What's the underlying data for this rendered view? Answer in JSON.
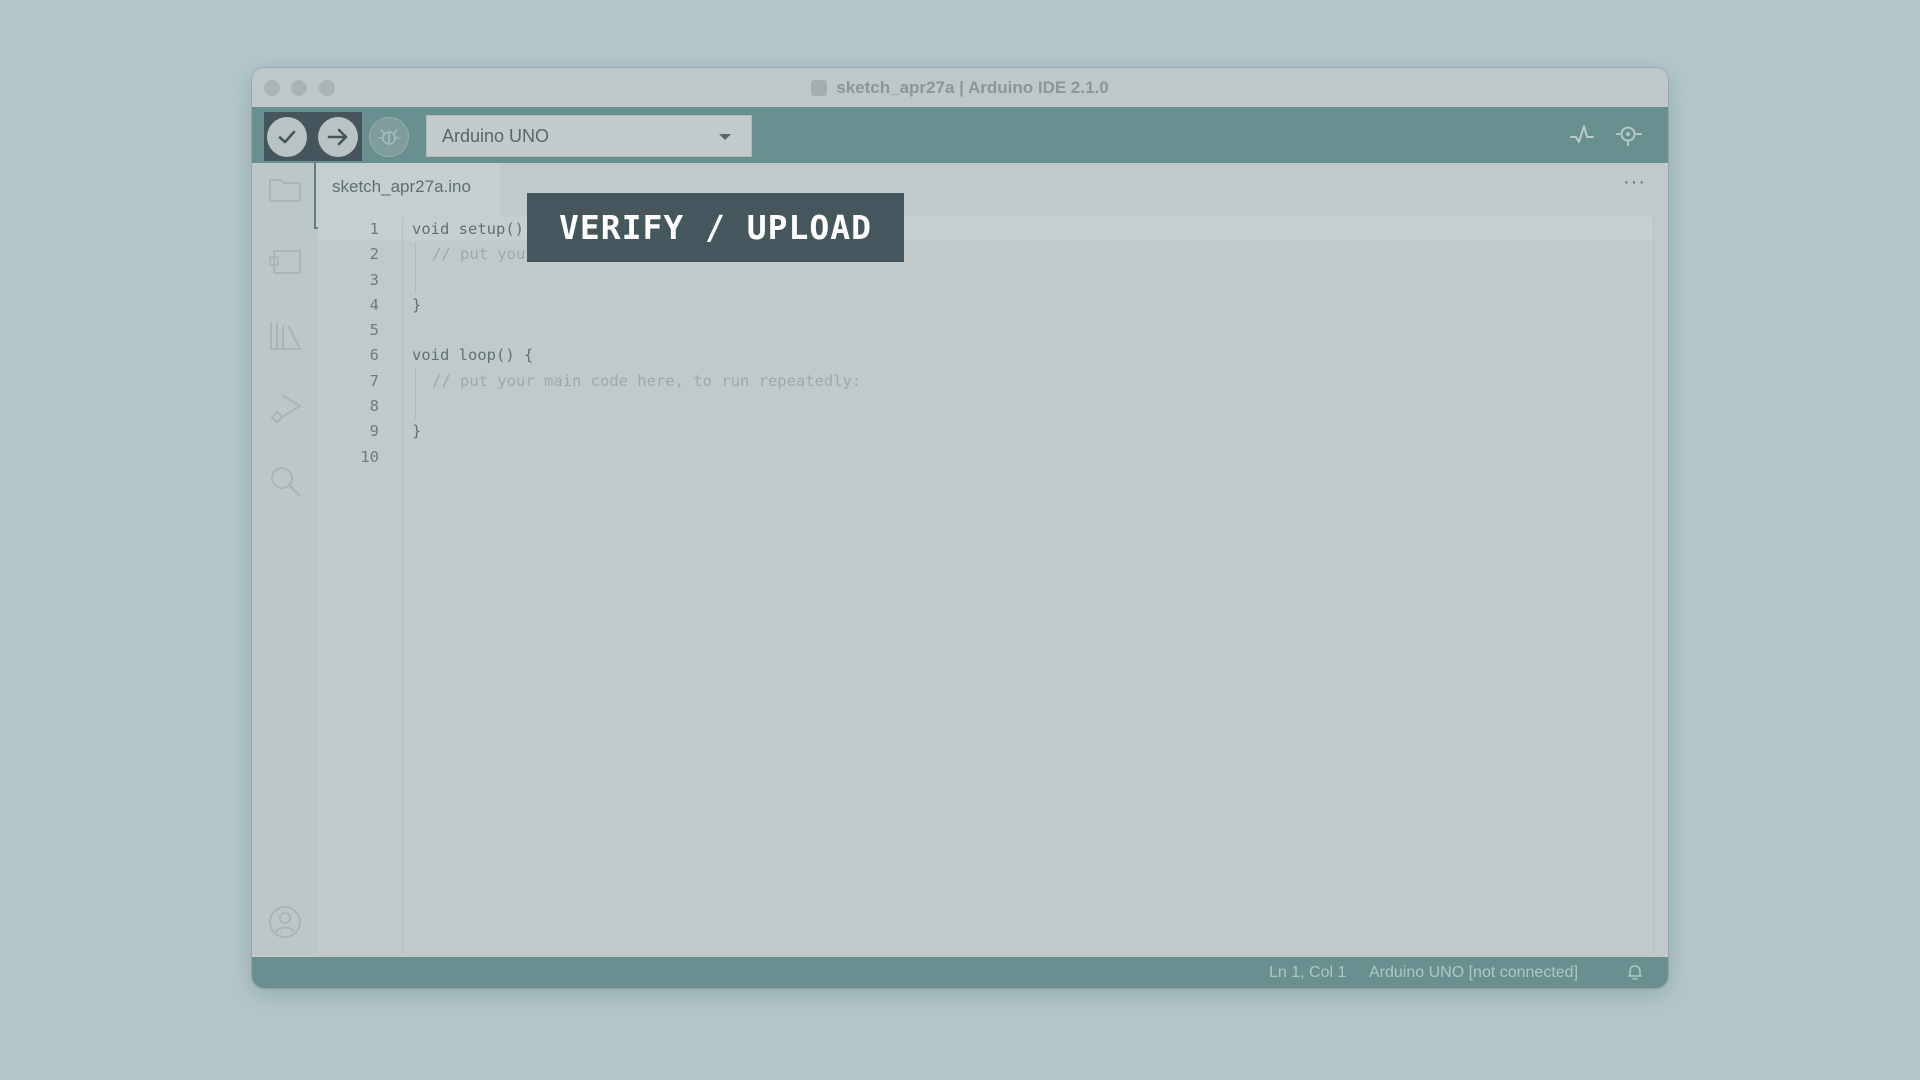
{
  "window": {
    "title": "sketch_apr27a | Arduino IDE 2.1.0"
  },
  "toolbar": {
    "board_name": "Arduino UNO",
    "verify_icon": "checkmark-icon",
    "upload_icon": "arrow-right-icon",
    "debug_icon": "debug-icon"
  },
  "tab": {
    "filename": "sketch_apr27a.ino",
    "more": "···"
  },
  "code": {
    "lines": [
      {
        "num": "1",
        "text": "void setup() {"
      },
      {
        "num": "2",
        "text": "// put your setup code here, to run once:"
      },
      {
        "num": "3",
        "text": ""
      },
      {
        "num": "4",
        "text": "}"
      },
      {
        "num": "5",
        "text": ""
      },
      {
        "num": "6",
        "text": "void loop() {"
      },
      {
        "num": "7",
        "text": "// put your main code here, to run repeatedly:"
      },
      {
        "num": "8",
        "text": ""
      },
      {
        "num": "9",
        "text": "}"
      },
      {
        "num": "10",
        "text": ""
      }
    ]
  },
  "overlay": {
    "label": "VERIFY / UPLOAD"
  },
  "status": {
    "position": "Ln 1, Col 1",
    "board": "Arduino UNO [not connected]"
  },
  "colors": {
    "accent": "#6a8f8f",
    "overlay_bg": "#45575c",
    "toolbar_dark": "#44565c"
  }
}
